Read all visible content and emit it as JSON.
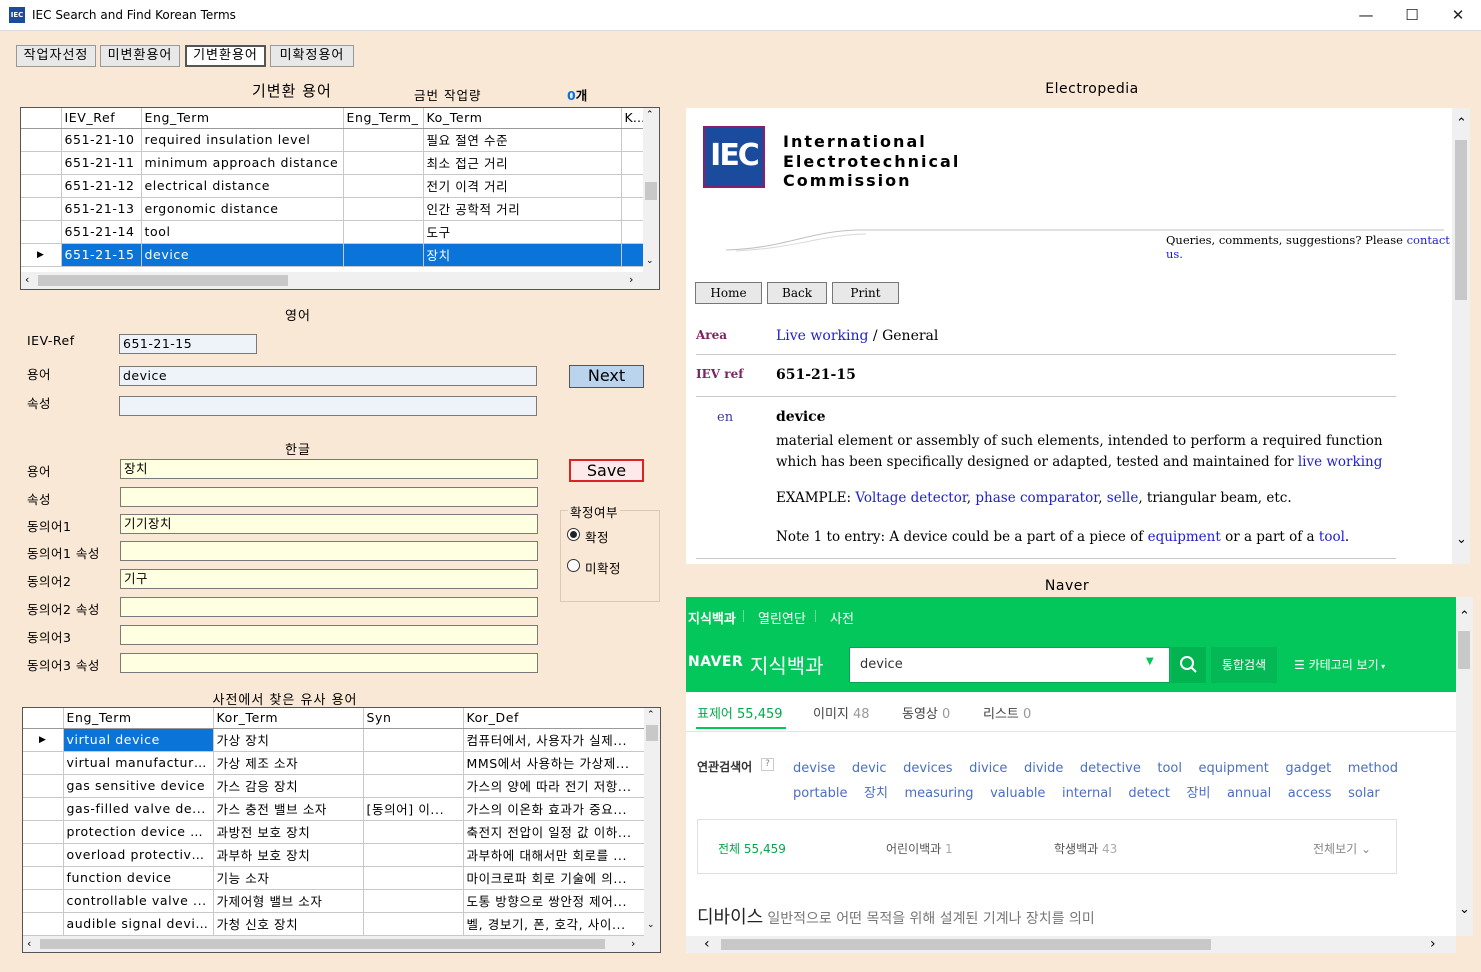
{
  "window": {
    "title": "IEC Search and Find Korean Terms",
    "app_icon": "IEC",
    "minimize": "—",
    "maximize": "☐",
    "close": "✕"
  },
  "tabs": [
    "작업자선정",
    "미변환용어",
    "기변환용어",
    "미확정용어"
  ],
  "top_section": {
    "title": "기변환 용어",
    "count_label": "금번 작업량",
    "count_value": "0",
    "count_unit": "개"
  },
  "grid1": {
    "columns": [
      "IEV_Ref",
      "Eng_Term",
      "Eng_Term_",
      "Ko_Term",
      "Ko"
    ],
    "rows": [
      {
        "ref": "651-21-10",
        "eng": "required insulation level",
        "eng2": "",
        "ko": "필요 절연 수준"
      },
      {
        "ref": "651-21-11",
        "eng": "minimum approach distance",
        "eng2": "",
        "ko": "최소 접근 거리"
      },
      {
        "ref": "651-21-12",
        "eng": "electrical distance",
        "eng2": "",
        "ko": "전기 이격 거리"
      },
      {
        "ref": "651-21-13",
        "eng": "ergonomic distance",
        "eng2": "",
        "ko": "인간 공학적 거리"
      },
      {
        "ref": "651-21-14",
        "eng": "tool",
        "eng2": "",
        "ko": "도구"
      },
      {
        "ref": "651-21-15",
        "eng": "device",
        "eng2": "",
        "ko": "장치"
      }
    ],
    "selected_index": 5
  },
  "english": {
    "title": "영어",
    "ref_label": "IEV-Ref",
    "ref_value": "651-21-15",
    "term_label": "용어",
    "term_value": "device",
    "attr_label": "속성",
    "attr_value": "",
    "next_label": "Next"
  },
  "korean": {
    "title": "한글",
    "save_label": "Save",
    "fields": [
      {
        "label": "용어",
        "value": "장치"
      },
      {
        "label": "속성",
        "value": ""
      },
      {
        "label": "동의어1",
        "value": "기기장치"
      },
      {
        "label": "동의어1 속성",
        "value": ""
      },
      {
        "label": "동의어2",
        "value": "기구"
      },
      {
        "label": "동의어2 속성",
        "value": ""
      },
      {
        "label": "동의어3",
        "value": ""
      },
      {
        "label": "동의어3 속성",
        "value": ""
      }
    ],
    "confirm": {
      "title": "확정여부",
      "options": [
        "확정",
        "미확정"
      ],
      "selected": "확정"
    }
  },
  "similar": {
    "title": "사전에서 찾은 유사 용어",
    "columns": [
      "Eng_Term",
      "Kor_Term",
      "Syn",
      "Kor_Def"
    ],
    "rows": [
      {
        "eng": "virtual device",
        "kor": "가상 장치",
        "syn": "",
        "def": "컴퓨터에서, 사용자가 실제..."
      },
      {
        "eng": "virtual manufacturi...",
        "kor": "가상 제조 소자",
        "syn": "",
        "def": "MMS에서 사용하는 가상제..."
      },
      {
        "eng": "gas sensitive device",
        "kor": "가스 감응 장치",
        "syn": "",
        "def": "가스의 양에 따라 전기 저항..."
      },
      {
        "eng": "gas-filled valve de...",
        "kor": "가스 충전 밸브 소자",
        "syn": "[동의어] 이...",
        "def": "가스의 이온화 효과가 중요..."
      },
      {
        "eng": "protection device a...",
        "kor": "과방전 보호 장치",
        "syn": "",
        "def": "축전지 전압이 일정 값 이하..."
      },
      {
        "eng": "overload protective...",
        "kor": "과부하 보호 장치",
        "syn": "",
        "def": "과부하에 대해서만 회로를 ..."
      },
      {
        "eng": "function device",
        "kor": "기능 소자",
        "syn": "",
        "def": "마이크로파 회로 기술에 의..."
      },
      {
        "eng": "controllable valve ...",
        "kor": "가제어형 밸브 소자",
        "syn": "",
        "def": "도통 방향으로 쌍안정 제어..."
      },
      {
        "eng": "audible signal device",
        "kor": "가청 신호 장치",
        "syn": "",
        "def": "벨, 경보기, 폰, 호각, 사이..."
      }
    ]
  },
  "electropedia": {
    "title": "Electropedia",
    "logo_text": "IEC",
    "org_line1": "International",
    "org_line2": "Electrotechnical",
    "org_line3": "Commission",
    "queries_text": "Queries, comments, suggestions? Please ",
    "contact_link": "contact us.",
    "buttons": [
      "Home",
      "Back",
      "Print"
    ],
    "area_label": "Area",
    "area_link": "Live working",
    "area_rest": " / General",
    "iev_label": "IEV ref",
    "iev_value": "651-21-15",
    "lang": "en",
    "term": "device",
    "def_line1": "material element or assembly of such elements, intended to perform a required function",
    "def_line2": "which has been specifically designed or adapted, tested and maintained for ",
    "def_link": "live working",
    "example_prefix": "EXAMPLE: ",
    "ex1": "Voltage detector",
    "ex2": "phase comparator",
    "ex3": "selle",
    "example_rest": ", triangular beam, etc.",
    "note_prefix": "Note 1 to entry: A device could be a part of a piece of ",
    "note_link1": "equipment",
    "note_mid": " or a part of a ",
    "note_link2": "tool",
    "note_end": "."
  },
  "naver": {
    "title": "Naver",
    "top_tabs": [
      "지식백과",
      "열린연단",
      "사전"
    ],
    "logo": "NAVER",
    "logo_sub": "지식백과",
    "search_value": "device",
    "search_btn": "통합검색",
    "category_btn": "카테고리 보기",
    "result_tabs": [
      {
        "label": "표제어",
        "count": "55,459"
      },
      {
        "label": "이미지",
        "count": "48"
      },
      {
        "label": "동영상",
        "count": "0"
      },
      {
        "label": "리스트",
        "count": "0"
      }
    ],
    "related_label": "연관검색어",
    "related_help": "?",
    "related_row1": [
      "devise",
      "devic",
      "devices",
      "divice",
      "divide",
      "detective",
      "tool",
      "equipment",
      "gadget",
      "method"
    ],
    "related_row2": [
      "portable",
      "장치",
      "measuring",
      "valuable",
      "internal",
      "detect",
      "장비",
      "annual",
      "access",
      "solar"
    ],
    "filters": [
      {
        "label": "전체",
        "count": "55,459"
      },
      {
        "label": "어린이백과",
        "count": "1"
      },
      {
        "label": "학생백과",
        "count": "43"
      }
    ],
    "view_all": "전체보기",
    "result_title": "디바이스",
    "result_desc": "일반적으로 어떤 목적을 위해 설계된 기계나 장치를 의미"
  },
  "colors": {
    "panel": "#f9e8d5",
    "selection": "#0a74d8",
    "naver_green": "#03c75a",
    "link": "#1c1cd6"
  }
}
